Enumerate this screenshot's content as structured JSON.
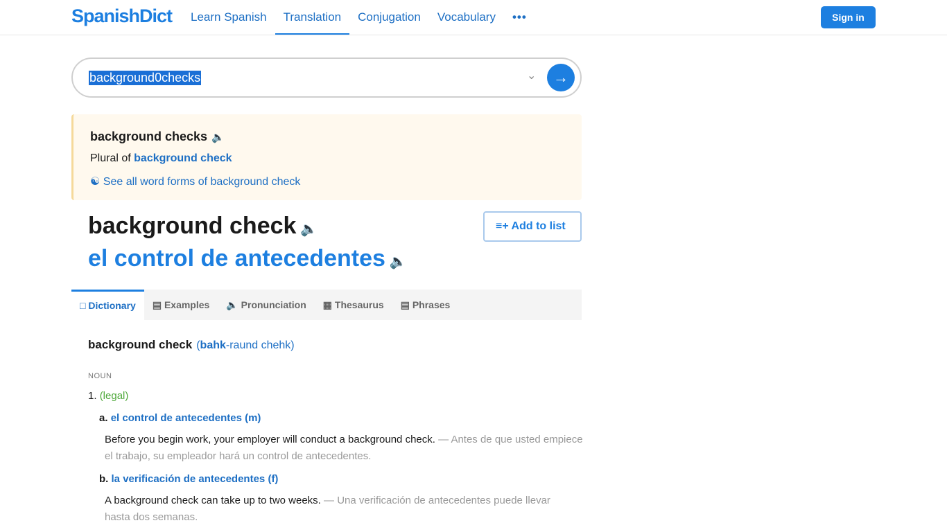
{
  "header": {
    "logo": "SpanishDict",
    "nav": [
      "Learn Spanish",
      "Translation",
      "Conjugation",
      "Vocabulary"
    ],
    "more": "•••",
    "active": "Translation",
    "sign_in": "Sign in"
  },
  "search": {
    "value": "background0checks"
  },
  "note": {
    "title": "background checks",
    "plural_prefix": "Plural of",
    "plural_link": "background check",
    "word_forms": "See all word forms of background check"
  },
  "headword": {
    "en": "background check",
    "es": "el control de antecedentes",
    "add_to_list": "Add to list"
  },
  "tabs": [
    "Dictionary",
    "Examples",
    "Pronunciation",
    "Thesaurus",
    "Phrases"
  ],
  "entry": {
    "word": "background check",
    "pron_stress": "bahk",
    "pron_rest": "-raund chehk",
    "pos": "NOUN",
    "sense_num": "1.",
    "sense_label": "(legal)",
    "translations": [
      {
        "letter": "a.",
        "text": "el control de antecedentes (m)",
        "example_en": "Before you begin work, your employer will conduct a background check.",
        "example_es": "Antes de que usted empiece el trabajo, su empleador hará un control de antecedentes."
      },
      {
        "letter": "b.",
        "text": "la verificación de antecedentes (f)",
        "example_en": "A background check can take up to two weeks.",
        "example_es": "Una verificación de antecedentes puede llevar hasta dos semanas."
      }
    ]
  }
}
